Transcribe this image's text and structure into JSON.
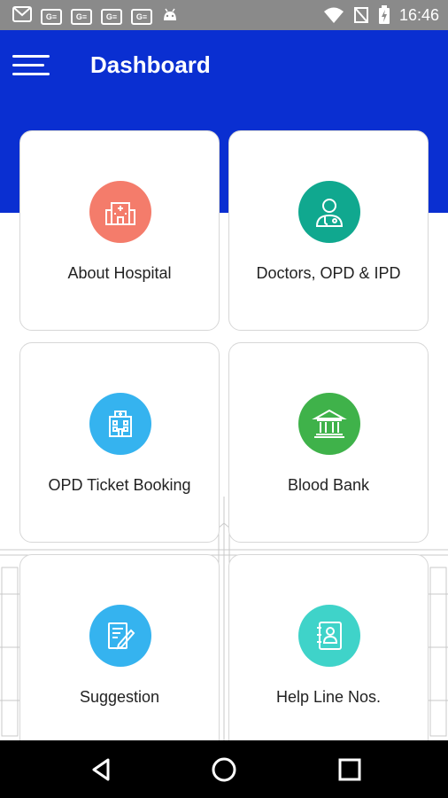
{
  "status_bar": {
    "time": "16:46"
  },
  "app_bar": {
    "title": "Dashboard"
  },
  "colors": {
    "primary": "#0a2fd1",
    "about": "#f47c6b",
    "doctors": "#10a88f",
    "opd": "#35b3ef",
    "blood": "#3fb24a",
    "suggestion": "#35b3ef",
    "helpline": "#3fd3c9"
  },
  "cards": [
    {
      "label": "About Hospital",
      "icon": "hospital-building-icon"
    },
    {
      "label": "Doctors, OPD & IPD",
      "icon": "doctor-icon"
    },
    {
      "label": "OPD Ticket Booking",
      "icon": "hospital-booking-icon"
    },
    {
      "label": "Blood Bank",
      "icon": "bank-building-icon"
    },
    {
      "label": "Suggestion",
      "icon": "pen-paper-icon"
    },
    {
      "label": "Help Line Nos.",
      "icon": "contact-book-icon"
    }
  ]
}
